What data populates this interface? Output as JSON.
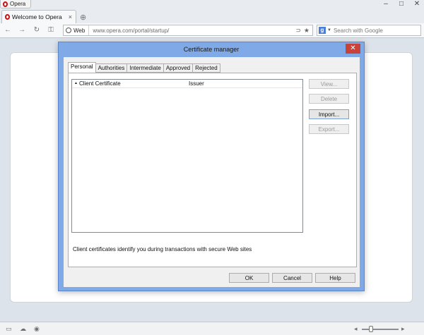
{
  "browser": {
    "menu_label": "Opera",
    "tab_title": "Welcome to Opera",
    "address_badge": "Web",
    "url": "www.opera.com/portal/startup/",
    "search_placeholder": "Search with Google",
    "search_engine_letter": "g"
  },
  "icons": {
    "back": "←",
    "forward": "→",
    "reload": "↻",
    "key": "⚿",
    "rss": "⊃",
    "star": "★",
    "new_tab": "⊕",
    "minimize": "–",
    "maximize": "□",
    "close": "✕",
    "tab_close": "×",
    "panel": "▭",
    "cloud": "☁",
    "turbo": "◉",
    "sort_up": "▲",
    "zoom_out": "◂",
    "zoom_in": "▸"
  },
  "dialog": {
    "title": "Certificate manager",
    "tabs": [
      "Personal",
      "Authorities",
      "Intermediate",
      "Approved",
      "Rejected"
    ],
    "active_tab": "Personal",
    "columns": [
      "Client Certificate",
      "Issuer"
    ],
    "description": "Client certificates identify you during transactions with secure Web sites",
    "side_buttons": {
      "view": "View...",
      "delete": "Delete",
      "import": "Import...",
      "export": "Export..."
    },
    "bottom_buttons": {
      "ok": "OK",
      "cancel": "Cancel",
      "help": "Help"
    }
  },
  "colors": {
    "dialog_frame": "#7fa9e7",
    "close_button": "#c7433a",
    "opera_red": "#cc0f16"
  }
}
